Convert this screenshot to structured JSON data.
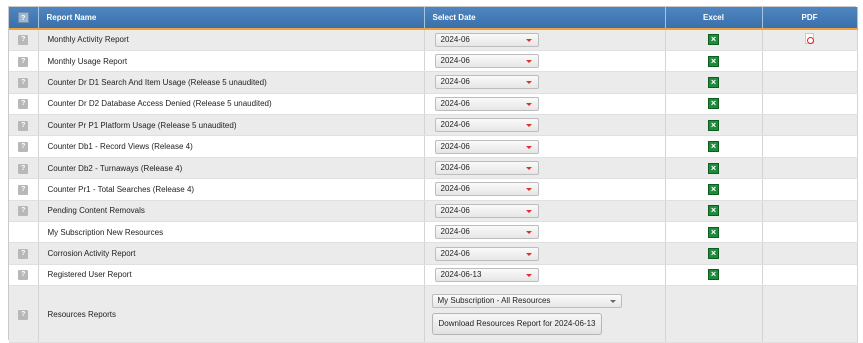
{
  "header": {
    "help_icon": "?",
    "report_name": "Report Name",
    "select_date": "Select Date",
    "excel": "Excel",
    "pdf": "PDF"
  },
  "rows": [
    {
      "name": "Monthly Activity Report",
      "date": "2024-06",
      "help": true,
      "excel": true,
      "pdf": true
    },
    {
      "name": "Monthly Usage Report",
      "date": "2024-06",
      "help": true,
      "excel": true,
      "pdf": false
    },
    {
      "name": "Counter Dr D1 Search And Item Usage (Release 5 unaudited)",
      "date": "2024-06",
      "help": true,
      "excel": true,
      "pdf": false
    },
    {
      "name": "Counter Dr D2 Database Access Denied (Release 5 unaudited)",
      "date": "2024-06",
      "help": true,
      "excel": true,
      "pdf": false
    },
    {
      "name": "Counter Pr P1 Platform Usage (Release 5 unaudited)",
      "date": "2024-06",
      "help": true,
      "excel": true,
      "pdf": false
    },
    {
      "name": "Counter Db1 - Record Views (Release 4)",
      "date": "2024-06",
      "help": true,
      "excel": true,
      "pdf": false
    },
    {
      "name": "Counter Db2 - Turnaways (Release 4)",
      "date": "2024-06",
      "help": true,
      "excel": true,
      "pdf": false
    },
    {
      "name": "Counter Pr1 - Total Searches (Release 4)",
      "date": "2024-06",
      "help": true,
      "excel": true,
      "pdf": false
    },
    {
      "name": "Pending Content Removals",
      "date": "2024-06",
      "help": true,
      "excel": true,
      "pdf": false
    },
    {
      "name": "My Subscription New Resources",
      "date": "2024-06",
      "help": false,
      "excel": true,
      "pdf": false
    },
    {
      "name": "Corrosion Activity Report",
      "date": "2024-06",
      "help": true,
      "excel": true,
      "pdf": false
    },
    {
      "name": "Registered User Report",
      "date": "2024-06-13",
      "help": true,
      "excel": true,
      "pdf": false
    }
  ],
  "resources": {
    "name": "Resources Reports",
    "select_value": "My Subscription - All Resources",
    "button_label": "Download Resources Report for 2024-06-13"
  },
  "colors": {
    "header_bg": "#3a6fa8",
    "header_accent": "#f0a23c",
    "excel_green": "#1f8a3a",
    "pdf_red": "#dd2222",
    "select_arrow": "#d9342b"
  },
  "icons": {
    "help": "help-icon",
    "excel": "excel-icon",
    "pdf": "pdf-icon"
  }
}
